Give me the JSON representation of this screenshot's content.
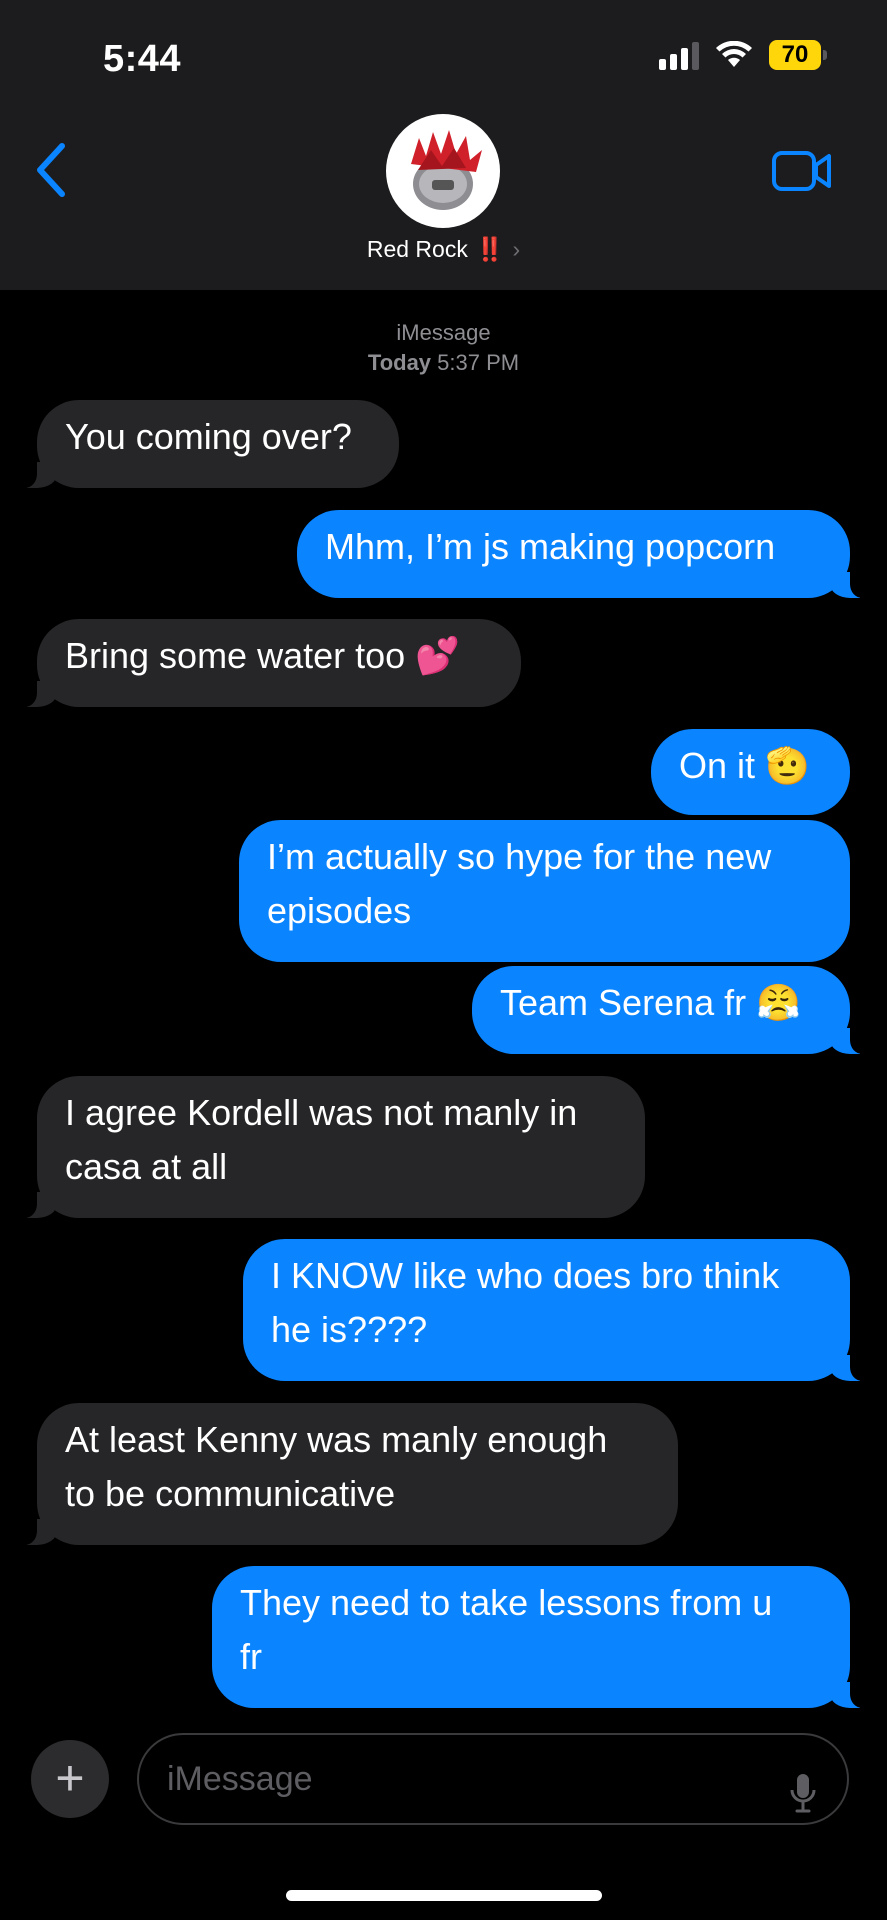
{
  "status_bar": {
    "time": "5:44",
    "battery": "70"
  },
  "header": {
    "contact_name": "Red Rock",
    "contact_emoji": "‼️",
    "chevron": "›"
  },
  "thread": {
    "service": "iMessage",
    "date_label": "Today",
    "time_label": "5:37 PM",
    "messages": [
      {
        "from": "them",
        "lines": [
          "You coming over?"
        ]
      },
      {
        "from": "me",
        "lines": [
          "Mhm, I’m js making popcorn"
        ]
      },
      {
        "from": "them",
        "lines": [
          "Bring some water too 💕"
        ]
      },
      {
        "from": "me",
        "lines": [
          "On it 🫡"
        ]
      },
      {
        "from": "me",
        "lines": [
          "I’m actually so hype for the new",
          "episodes"
        ]
      },
      {
        "from": "me",
        "lines": [
          "Team Serena fr 😤"
        ]
      },
      {
        "from": "them",
        "lines": [
          "I agree Kordell was not manly in",
          "casa at all"
        ]
      },
      {
        "from": "me",
        "lines": [
          "I KNOW like who does bro think",
          "he is????"
        ]
      },
      {
        "from": "them",
        "lines": [
          "At least Kenny was manly enough",
          "to be communicative"
        ]
      },
      {
        "from": "me",
        "lines": [
          "They need to take lessons from u",
          "fr"
        ]
      }
    ]
  },
  "composer": {
    "add_label": "+",
    "placeholder": "iMessage"
  },
  "colors": {
    "outgoing": "#0a84ff",
    "incoming": "#262628",
    "header": "#1c1c1e",
    "battery": "#ffd60a"
  }
}
